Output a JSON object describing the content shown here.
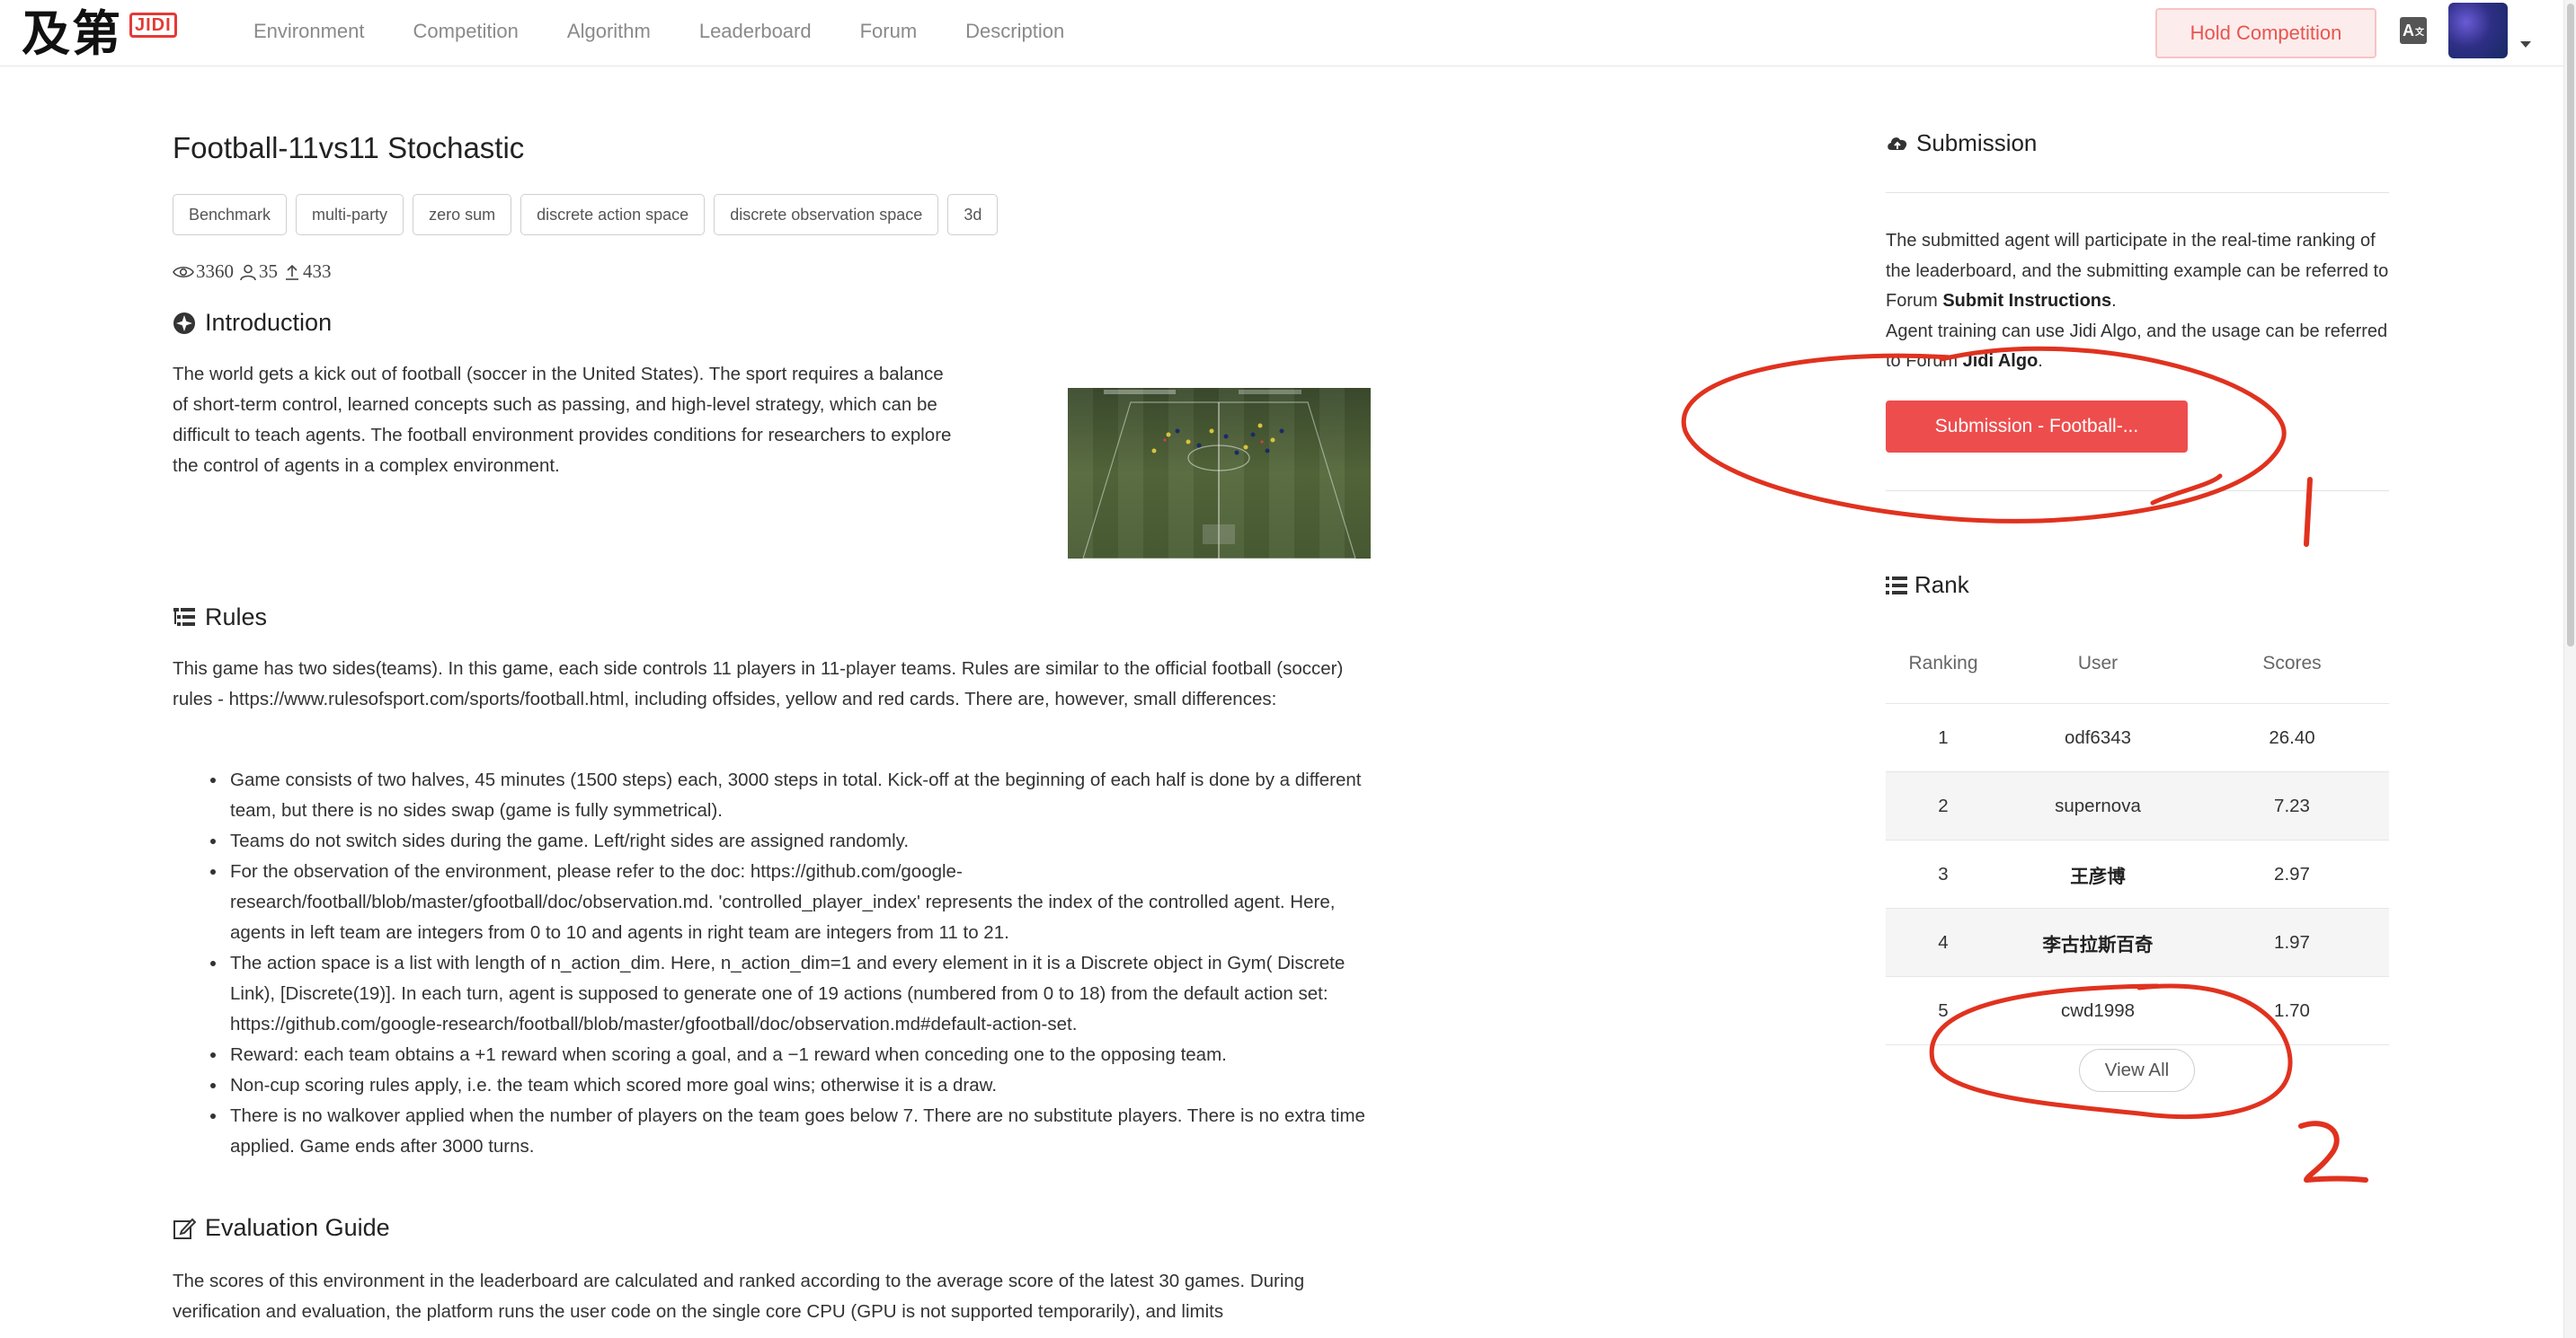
{
  "nav": {
    "logo_text": "及第",
    "logo_badge": "JIDI",
    "links": [
      "Environment",
      "Competition",
      "Algorithm",
      "Leaderboard",
      "Forum",
      "Description"
    ],
    "hold_competition": "Hold Competition",
    "lang_icon": "translate-icon"
  },
  "main": {
    "title": "Football-11vs11 Stochastic",
    "tags": [
      "Benchmark",
      "multi-party",
      "zero sum",
      "discrete action space",
      "discrete observation space",
      "3d"
    ],
    "stats": {
      "views": "3360",
      "users": "35",
      "submissions": "433"
    },
    "introduction": {
      "heading": "Introduction",
      "text": "The world gets a kick out of football (soccer in the United States). The sport requires a balance of short-term control, learned concepts such as passing, and high-level strategy, which can be difficult to teach agents. The football environment provides conditions for researchers to explore the control of agents in a complex environment."
    },
    "rules": {
      "heading": "Rules",
      "text": "This game has two sides(teams). In this game, each side controls 11 players in 11-player teams. Rules are similar to the official football (soccer) rules - https://www.rulesofsport.com/sports/football.html, including offsides, yellow and red cards. There are, however, small differences:",
      "items": [
        "Game consists of two halves, 45 minutes (1500 steps) each, 3000 steps in total. Kick-off at the beginning of each half is done by a different team, but there is no sides swap (game is fully symmetrical).",
        "Teams do not switch sides during the game. Left/right sides are assigned randomly.",
        "For the observation of the environment, please refer to the doc: https://github.com/google-research/football/blob/master/gfootball/doc/observation.md. 'controlled_player_index' represents the index of the controlled agent. Here, agents in left team are integers from 0 to 10 and agents in right team are integers from 11 to 21.",
        "The action space is a list with length of n_action_dim. Here, n_action_dim=1 and every element in it is a Discrete object in Gym( Discrete Link), [Discrete(19)]. In each turn, agent is supposed to generate one of 19 actions (numbered from 0 to 18) from the default action set: https://github.com/google-research/football/blob/master/gfootball/doc/observation.md#default-action-set.",
        "Reward: each team obtains a +1 reward when scoring a goal, and a −1 reward when conceding one to the opposing team.",
        "Non-cup scoring rules apply, i.e. the team which scored more goal wins; otherwise it is a draw.",
        "There is no walkover applied when the number of players on the team goes below 7. There are no substitute players. There is no extra time applied. Game ends after 3000 turns."
      ]
    },
    "evaluation": {
      "heading": "Evaluation Guide",
      "text": "The scores of this environment in the leaderboard are calculated and ranked according to the average score of the latest 30 games. During verification and evaluation, the platform runs the user code on the single core CPU (GPU is not supported temporarily), and limits"
    }
  },
  "sidebar": {
    "submission": {
      "heading": "Submission",
      "text_1": "The submitted agent will participate in the real-time ranking of the leaderboard, and the submitting example can be referred to Forum ",
      "link_1": "Submit Instructions",
      "text_1_end": ".",
      "text_2": "Agent training can use Jidi Algo, and the usage can be referred to Forum ",
      "link_2": "Jidi Algo",
      "text_2_end": ".",
      "button": "Submission - Football-..."
    },
    "rank": {
      "heading": "Rank",
      "columns": [
        "Ranking",
        "User",
        "Scores"
      ],
      "rows": [
        {
          "ranking": "1",
          "user": "odf6343",
          "score": "26.40"
        },
        {
          "ranking": "2",
          "user": "supernova",
          "score": "7.23"
        },
        {
          "ranking": "3",
          "user": "王彦博",
          "score": "2.97"
        },
        {
          "ranking": "4",
          "user": "李古拉斯百奇",
          "score": "1.97"
        },
        {
          "ranking": "5",
          "user": "cwd1998",
          "score": "1.70"
        }
      ],
      "view_all": "View All"
    }
  },
  "annotations": {
    "mark_1": "1",
    "mark_2": "2",
    "color": "#e0321f"
  }
}
